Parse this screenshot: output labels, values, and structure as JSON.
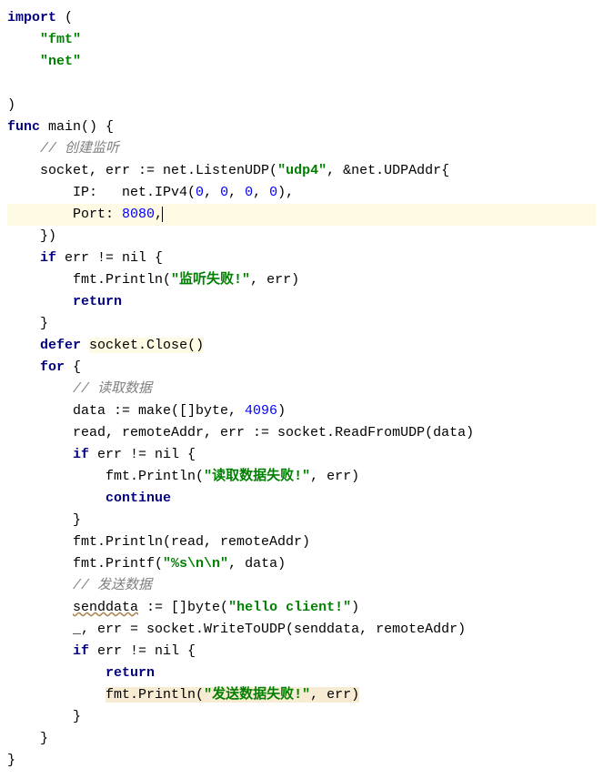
{
  "code": {
    "import_kw": "import",
    "fmt_str": "\"fmt\"",
    "net_str": "\"net\"",
    "func_kw": "func",
    "main_name": "main() {",
    "c_create_listen": "// 创建监听",
    "socket_err": "socket, err := net.ListenUDP(",
    "udp4_str": "\"udp4\"",
    "ampnet": ", &net.UDPAddr{",
    "ip_label": "IP:   net.IPv4(",
    "zero": "0",
    "comma_sp": ", ",
    "ip_close": "),",
    "port_label": "Port: ",
    "port_num": "8080",
    "port_after": ",",
    "brace_paren": "})",
    "if_kw": "if",
    "err_nil": " err != nil {",
    "println_open": "fmt.Println(",
    "listen_fail": "\"监听失败!\"",
    "err_close": ", err)",
    "return_kw": "return",
    "close_brace": "}",
    "defer_kw": "defer",
    "socket_close": "socket.Close()",
    "for_kw": "for",
    "for_open": " {",
    "c_read_data": "// 读取数据",
    "data_make": "data := make([]byte, ",
    "n4096": "4096",
    "paren_close": ")",
    "read_line": "read, remoteAddr, err := socket.ReadFromUDP(data)",
    "read_fail": "\"读取数据失败!\"",
    "continue_kw": "continue",
    "println_rr": "fmt.Println(read, remoteAddr)",
    "printf_open": "fmt.Printf(",
    "fmt_str2": "\"%s\\n\\n\"",
    "data_close": ", data)",
    "c_send_data": "// 发送数据",
    "senddata_var": "senddata",
    "senddata_rest": " := []byte(",
    "hello_str": "\"hello client!\"",
    "underscore_err": "_, err = socket.WriteToUDP(senddata, remoteAddr)",
    "send_fail": "\"发送数据失败!\""
  }
}
